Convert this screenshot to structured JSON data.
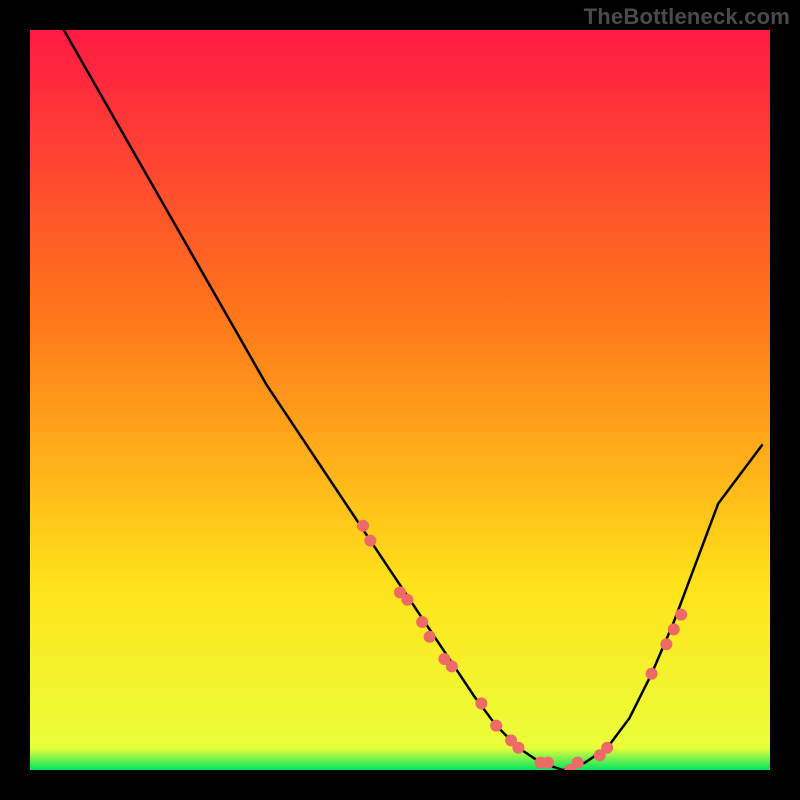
{
  "watermark": "TheBottleneck.com",
  "colors": {
    "background": "#000000",
    "gradient_top": "#ff1a44",
    "gradient_mid1": "#ff7a1a",
    "gradient_mid2": "#ffe21a",
    "gradient_bottom": "#00e660",
    "curve": "#000000",
    "marker": "#ed6a66"
  },
  "chart_data": {
    "type": "line",
    "title": "",
    "xlabel": "",
    "ylabel": "",
    "xlim": [
      0,
      100
    ],
    "ylim": [
      0,
      100
    ],
    "curve": {
      "x": [
        0,
        4,
        8,
        12,
        16,
        20,
        24,
        28,
        32,
        36,
        40,
        44,
        48,
        52,
        56,
        60,
        63,
        66,
        69,
        72,
        75,
        78,
        81,
        84,
        87,
        90,
        93,
        96,
        99
      ],
      "y": [
        108,
        101,
        94,
        87,
        80,
        73,
        66,
        59,
        52,
        46,
        40,
        34,
        28,
        22,
        16,
        10,
        6,
        3,
        1,
        0,
        1,
        3,
        7,
        13,
        20,
        28,
        36,
        40,
        44
      ]
    },
    "markers": {
      "x": [
        45,
        46,
        50,
        51,
        53,
        54,
        56,
        57,
        61,
        63,
        65,
        66,
        69,
        70,
        73,
        74,
        77,
        78,
        84,
        86,
        87,
        88
      ],
      "y": [
        33,
        31,
        24,
        23,
        20,
        18,
        15,
        14,
        9,
        6,
        4,
        3,
        1,
        1,
        0,
        1,
        2,
        3,
        13,
        17,
        19,
        21
      ]
    }
  }
}
